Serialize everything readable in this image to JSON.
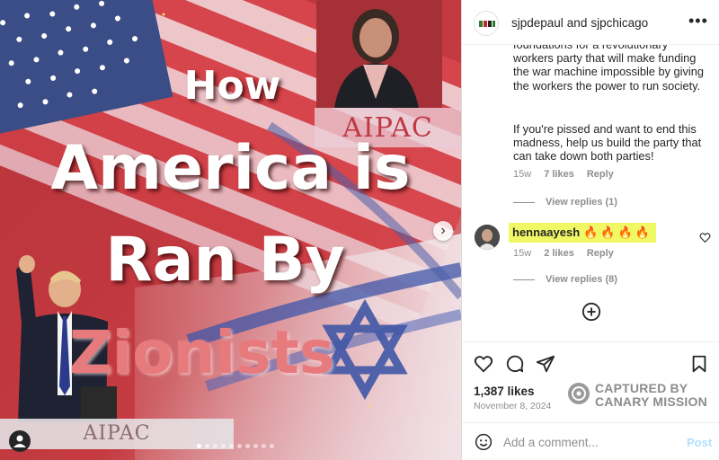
{
  "media": {
    "headline": {
      "line1": "How",
      "line2": "America is",
      "line3": "Ran By",
      "line4": "Zionists"
    },
    "podium_sign_top": "AIPAC",
    "podium_sign_bottom": "AIPAC",
    "carousel": {
      "total": 10,
      "active_index": 0
    },
    "icons": {
      "next": "chevron-right-icon",
      "tags": "user-tag-icon"
    }
  },
  "post": {
    "header": {
      "user1": "sjpdepaul",
      "separator": "and",
      "user2": "sjpchicago",
      "more_label": "•••"
    },
    "comments": {
      "first": {
        "paragraph1": "foundations for a revolutionary workers party that will make funding the war machine impossible by giving the workers the power to run society.",
        "paragraph2": "If you're pissed and want to end this madness, help us build the party that can take down both parties!",
        "time": "15w",
        "likes": "7 likes",
        "reply": "Reply",
        "view_replies": "View replies (1)"
      },
      "second": {
        "username": "hennaayesh",
        "emoji": "🔥🔥🔥🔥",
        "time": "15w",
        "likes": "2 likes",
        "reply": "Reply",
        "view_replies": "View replies (8)",
        "highlight_color": "#f0f964"
      }
    },
    "likes_count": "1,387 likes",
    "date": "November 8, 2024",
    "watermark": {
      "line1": "CAPTURED BY",
      "line2": "CANARY MISSION"
    },
    "add_comment": {
      "placeholder": "Add a comment...",
      "post_label": "Post"
    }
  }
}
